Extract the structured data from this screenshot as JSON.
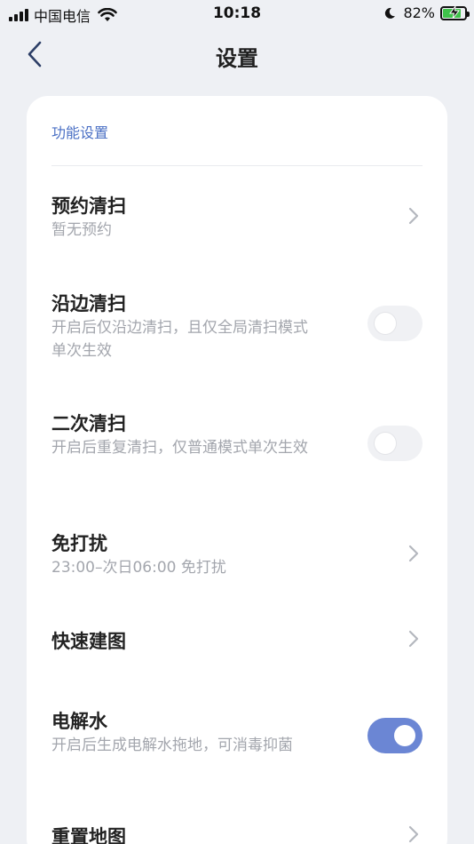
{
  "status_bar": {
    "carrier": "中国电信",
    "time": "10:18",
    "battery": "82%",
    "battery_level": 0.82,
    "icons": [
      "signal-icon",
      "wifi-icon",
      "moon-icon",
      "battery-icon",
      "charging-bolt-icon"
    ]
  },
  "header": {
    "title": "设置",
    "back_icon": "chevron-left-icon"
  },
  "section": {
    "title": "功能设置"
  },
  "rows": [
    {
      "title": "预约清扫",
      "subtitle": "暂无预约",
      "control": "chevron"
    },
    {
      "title": "沿边清扫",
      "subtitle": "开启后仅沿边清扫，且仅全局清扫模式单次生效",
      "control": "toggle",
      "on": false
    },
    {
      "title": "二次清扫",
      "subtitle": "开启后重复清扫，仅普通模式单次生效",
      "control": "toggle",
      "on": false
    },
    {
      "title": "免打扰",
      "subtitle": "23:00–次日06:00 免打扰",
      "control": "chevron"
    },
    {
      "title": "快速建图",
      "subtitle": "",
      "control": "chevron"
    },
    {
      "title": "电解水",
      "subtitle": "开启后生成电解水拖地，可消毒抑菌",
      "control": "toggle",
      "on": true
    },
    {
      "title": "重置地图",
      "subtitle": "",
      "control": "chevron"
    }
  ],
  "colors": {
    "accent": "#6b86d4",
    "section_title": "#4a6fc4",
    "background": "#eef0f4"
  }
}
